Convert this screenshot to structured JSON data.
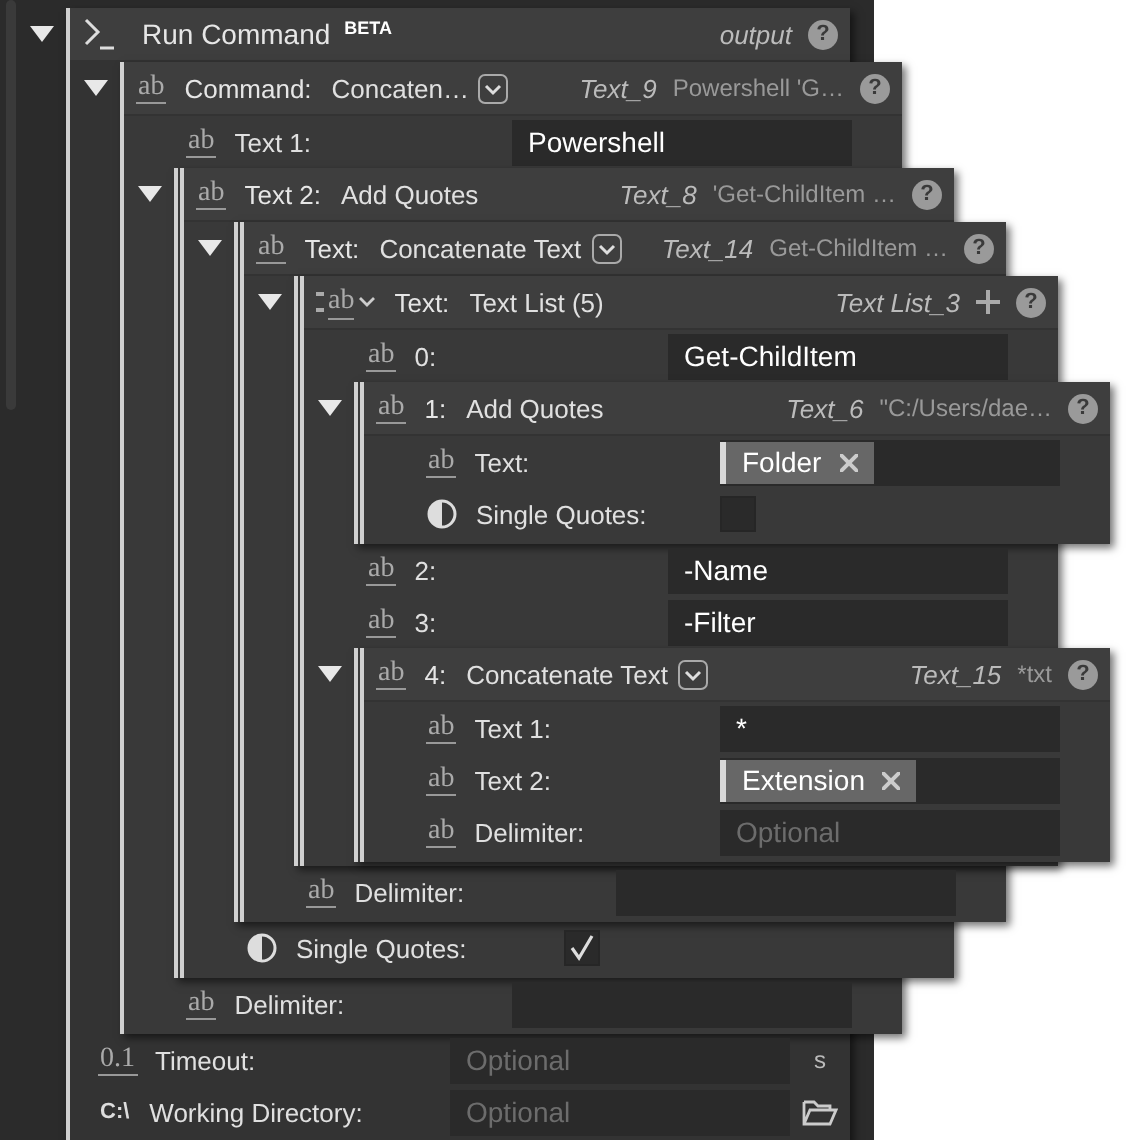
{
  "root": {
    "kind": "node",
    "expanded": true,
    "icon": {
      "kind": "terminal"
    },
    "label": "Run Command",
    "badge": "BETA",
    "var": "output",
    "help": "?",
    "children": [
      {
        "kind": "node",
        "expanded": true,
        "icon": {
          "kind": "glyph",
          "text": "ab",
          "underline": true
        },
        "label": "Command:",
        "value": "Concaten…",
        "dropdown": true,
        "var": "Text_9",
        "preview": "Powershell 'G…",
        "help": "?",
        "children": [
          {
            "kind": "field",
            "icon": {
              "kind": "glyph",
              "text": "ab",
              "underline": true
            },
            "label": "Text 1:",
            "value": "Powershell"
          },
          {
            "kind": "node",
            "expanded": true,
            "icon": {
              "kind": "glyph",
              "text": "ab",
              "underline": true
            },
            "label": "Text 2:",
            "value": "Add Quotes",
            "var": "Text_8",
            "preview": "'Get-ChildItem …",
            "help": "?",
            "children": [
              {
                "kind": "node",
                "expanded": true,
                "icon": {
                  "kind": "glyph",
                  "text": "ab",
                  "underline": true
                },
                "label": "Text:",
                "value": "Concatenate Text",
                "dropdown": true,
                "var": "Text_14",
                "preview": "Get-ChildItem …",
                "help": "?",
                "children": [
                  {
                    "kind": "node",
                    "expanded": true,
                    "icon": {
                      "kind": "list",
                      "text": "ab",
                      "underline": true
                    },
                    "label": "Text:",
                    "value": "Text List (5)",
                    "var": "Text List_3",
                    "add": true,
                    "help": "?",
                    "children": [
                      {
                        "kind": "field",
                        "icon": {
                          "kind": "glyph",
                          "text": "ab",
                          "underline": true
                        },
                        "label": "0:",
                        "value": "Get-ChildItem"
                      },
                      {
                        "kind": "node",
                        "expanded": true,
                        "icon": {
                          "kind": "glyph",
                          "text": "ab",
                          "underline": true
                        },
                        "label": "1:",
                        "value": "Add Quotes",
                        "var": "Text_6",
                        "preview": "\"C:/Users/dae…",
                        "help": "?",
                        "children": [
                          {
                            "kind": "chip",
                            "icon": {
                              "kind": "glyph",
                              "text": "ab",
                              "underline": true
                            },
                            "label": "Text:",
                            "chip": "Folder"
                          },
                          {
                            "kind": "checkbox",
                            "icon": {
                              "kind": "contrast"
                            },
                            "label": "Single Quotes:",
                            "checked": false
                          }
                        ]
                      },
                      {
                        "kind": "field",
                        "icon": {
                          "kind": "glyph",
                          "text": "ab",
                          "underline": true
                        },
                        "label": "2:",
                        "value": "-Name"
                      },
                      {
                        "kind": "field",
                        "icon": {
                          "kind": "glyph",
                          "text": "ab",
                          "underline": true
                        },
                        "label": "3:",
                        "value": "-Filter"
                      },
                      {
                        "kind": "node",
                        "expanded": true,
                        "icon": {
                          "kind": "glyph",
                          "text": "ab",
                          "underline": true
                        },
                        "label": "4:",
                        "value": "Concatenate Text",
                        "dropdown": true,
                        "var": "Text_15",
                        "preview": "*txt",
                        "help": "?",
                        "children": [
                          {
                            "kind": "field",
                            "icon": {
                              "kind": "glyph",
                              "text": "ab",
                              "underline": true
                            },
                            "label": "Text 1:",
                            "value": "*"
                          },
                          {
                            "kind": "chip",
                            "icon": {
                              "kind": "glyph",
                              "text": "ab",
                              "underline": true
                            },
                            "label": "Text 2:",
                            "chip": "Extension"
                          },
                          {
                            "kind": "field",
                            "icon": {
                              "kind": "glyph",
                              "text": "ab",
                              "underline": true
                            },
                            "label": "Delimiter:",
                            "placeholder": "Optional"
                          }
                        ]
                      }
                    ]
                  },
                  {
                    "kind": "field",
                    "icon": {
                      "kind": "glyph",
                      "text": "ab",
                      "underline": true
                    },
                    "label": "Delimiter:"
                  }
                ]
              },
              {
                "kind": "checkbox",
                "icon": {
                  "kind": "contrast"
                },
                "label": "Single Quotes:",
                "checked": true
              }
            ]
          },
          {
            "kind": "field",
            "icon": {
              "kind": "glyph",
              "text": "ab",
              "underline": true
            },
            "label": "Delimiter:"
          }
        ]
      },
      {
        "kind": "field",
        "icon": {
          "kind": "glyph",
          "text": "0.1",
          "underline": true
        },
        "label": "Timeout:",
        "placeholder": "Optional",
        "unit": "s"
      },
      {
        "kind": "field",
        "icon": {
          "kind": "glyph",
          "text": "C:\\",
          "underline": false
        },
        "label": "Working Directory:",
        "placeholder": "Optional",
        "browse": true
      }
    ]
  }
}
